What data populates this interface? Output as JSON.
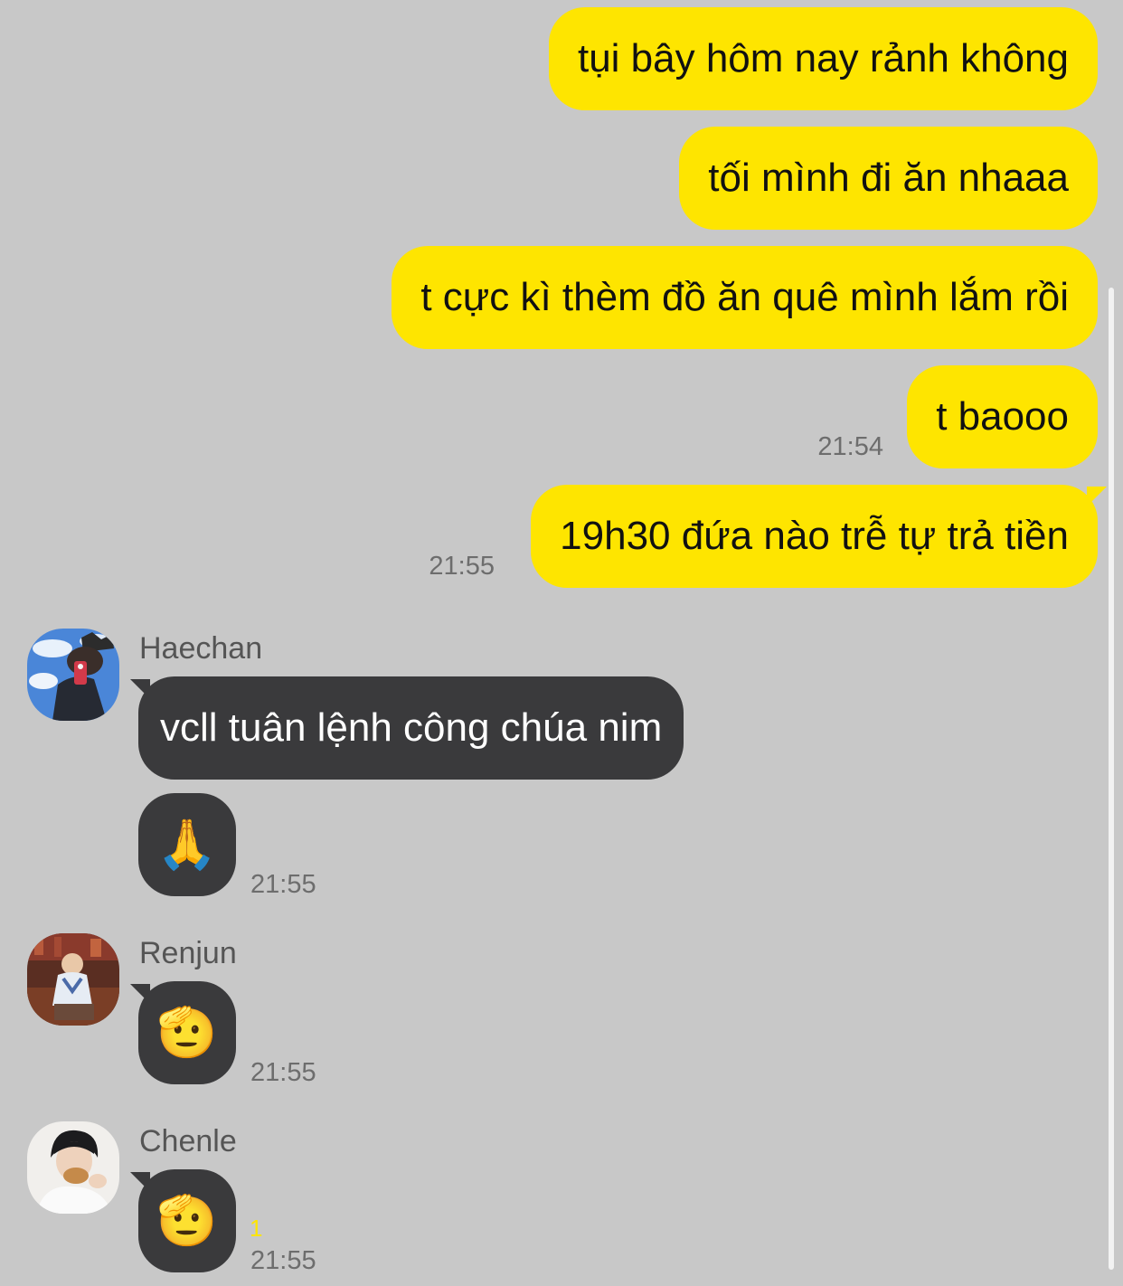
{
  "colors": {
    "background": "#c8c8c8",
    "outgoing_bubble": "#fee500",
    "incoming_bubble": "#3a3a3c",
    "timestamp": "#6d6d6d",
    "unread_count": "#fee500"
  },
  "outgoing": [
    {
      "text": "tụi bây hôm nay rảnh không"
    },
    {
      "text": "tối mình đi ăn nhaaa"
    },
    {
      "text": "t cực kì thèm đồ ăn quê mình lắm rồi"
    },
    {
      "text": "t baooo",
      "time": "21:54"
    },
    {
      "text": "19h30 đứa nào trễ tự trả tiền",
      "time": "21:55"
    }
  ],
  "incoming": [
    {
      "sender": "Haechan",
      "avatar_icon": "profile-photo-icon",
      "messages": [
        {
          "text": "vcll tuân lệnh công chúa nim"
        },
        {
          "emoji": "🙏",
          "emoji_icon": "folded-hands-icon",
          "time": "21:55"
        }
      ]
    },
    {
      "sender": "Renjun",
      "avatar_icon": "profile-photo-icon",
      "messages": [
        {
          "emoji": "🫡",
          "emoji_icon": "saluting-face-icon",
          "time": "21:55"
        }
      ]
    },
    {
      "sender": "Chenle",
      "avatar_icon": "profile-photo-icon",
      "messages": [
        {
          "emoji": "🫡",
          "emoji_icon": "saluting-face-icon",
          "unread": "1",
          "time": "21:55"
        }
      ]
    }
  ]
}
